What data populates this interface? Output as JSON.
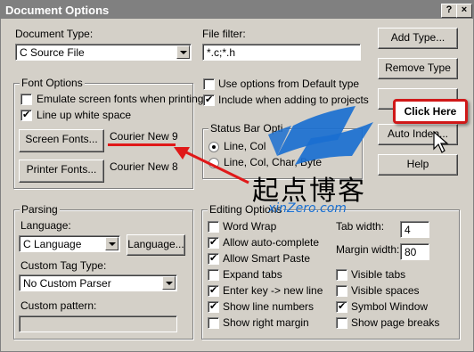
{
  "window": {
    "title": "Document Options"
  },
  "doc_type": {
    "label": "Document Type:",
    "value": "C Source File"
  },
  "file_filter": {
    "label": "File filter:",
    "value": "*.c;*.h"
  },
  "buttons": {
    "add_type": "Add Type...",
    "remove_type": "Remove Type",
    "auto_indent": "Auto Inden...",
    "help": "Help"
  },
  "default_type": {
    "use_options": "Use options from Default type",
    "include_projects": "Include when adding to projects"
  },
  "font_options": {
    "title": "Font Options",
    "emulate": "Emulate screen fonts when printing",
    "line_up": "Line up white space",
    "screen_fonts_button": "Screen Fonts...",
    "screen_font_value": "Courier New 9",
    "printer_fonts_button": "Printer Fonts...",
    "printer_font_value": "Courier New 8"
  },
  "status_bar": {
    "title": "Status Bar Opti",
    "opt1": "Line, Col",
    "opt2": "Line, Col, Char, Byte"
  },
  "parsing": {
    "title": "Parsing",
    "language_label": "Language:",
    "language_value": "C Language",
    "language_button": "Language...",
    "custom_tag_label": "Custom Tag Type:",
    "custom_tag_value": "No Custom Parser",
    "custom_pattern_label": "Custom pattern:",
    "custom_pattern_value": ""
  },
  "editing": {
    "title": "Editing Options",
    "word_wrap": "Word Wrap",
    "auto_complete": "Allow auto-complete",
    "smart_paste": "Allow Smart Paste",
    "expand_tabs": "Expand tabs",
    "enter_key": "Enter key -> new line",
    "line_numbers": "Show line numbers",
    "right_margin": "Show right margin",
    "tab_width_label": "Tab width:",
    "tab_width_value": "4",
    "margin_width_label": "Margin width:",
    "margin_width_value": "80",
    "visible_tabs": "Visible tabs",
    "visible_spaces": "Visible spaces",
    "symbol_window": "Symbol Window",
    "page_breaks": "Show page breaks"
  },
  "annotation": {
    "callout": "Click Here"
  },
  "watermark": {
    "chinese": "起点博客",
    "url": "xinZero.com"
  },
  "colors": {
    "callout_border": "#d01818",
    "watermark_blue": "#1a6fd0",
    "titlebar": "#808080"
  }
}
